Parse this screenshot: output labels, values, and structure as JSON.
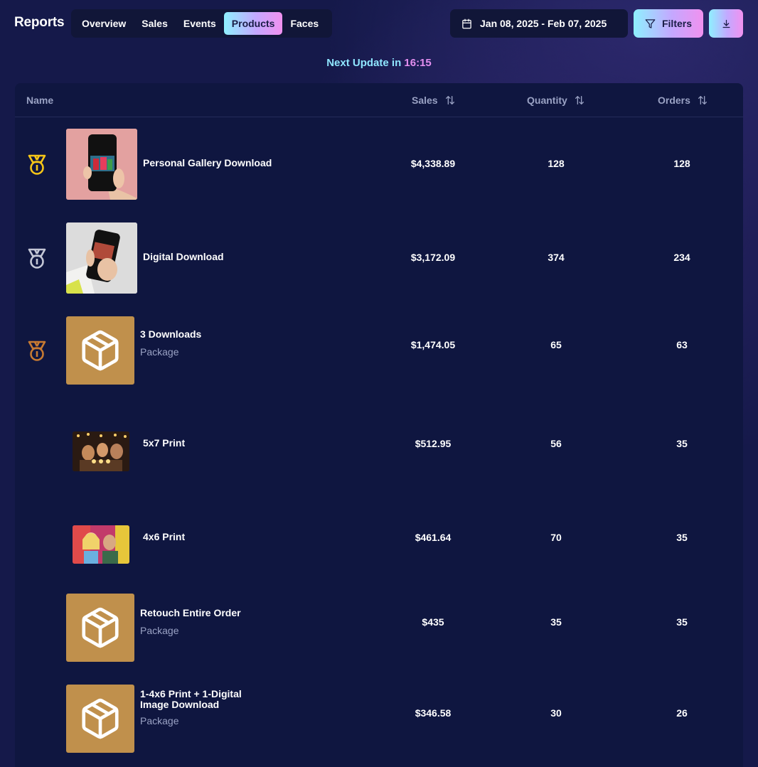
{
  "header": {
    "title": "Reports",
    "tabs": [
      "Overview",
      "Sales",
      "Events",
      "Products",
      "Faces"
    ],
    "active_tab": "Products",
    "date_range": "Jan 08, 2025 - Feb 07, 2025",
    "filters_label": "Filters",
    "download_icon": "download-icon",
    "calendar_icon": "calendar-icon",
    "filter_icon": "filter-icon"
  },
  "update": {
    "label": "Next Update in",
    "time": "16:15"
  },
  "table": {
    "columns": {
      "name": "Name",
      "sales": "Sales",
      "quantity": "Quantity",
      "orders": "Orders"
    },
    "sort_icon": "sort-arrows-icon",
    "rows": [
      {
        "name": "Personal Gallery Download",
        "subtitle": "",
        "sales": "$4,338.89",
        "quantity": "128",
        "orders": "128",
        "rank": "gold",
        "thumb": "phone-photo-pink"
      },
      {
        "name": "Digital Download",
        "subtitle": "",
        "sales": "$3,172.09",
        "quantity": "374",
        "orders": "234",
        "rank": "silver",
        "thumb": "phone-photo-white"
      },
      {
        "name": "3 Downloads",
        "subtitle": "Package",
        "sales": "$1,474.05",
        "quantity": "65",
        "orders": "63",
        "rank": "bronze",
        "thumb": "package-icon"
      },
      {
        "name": "5x7 Print",
        "subtitle": "",
        "sales": "$512.95",
        "quantity": "56",
        "orders": "35",
        "rank": "",
        "thumb": "party-photo"
      },
      {
        "name": "4x6 Print",
        "subtitle": "",
        "sales": "$461.64",
        "quantity": "70",
        "orders": "35",
        "rank": "",
        "thumb": "festival-photo"
      },
      {
        "name": "Retouch Entire Order",
        "subtitle": "Package",
        "sales": "$435",
        "quantity": "35",
        "orders": "35",
        "rank": "",
        "thumb": "package-icon"
      },
      {
        "name": "1-4x6 Print + 1-Digital Image Download",
        "subtitle": "Package",
        "sales": "$346.58",
        "quantity": "30",
        "orders": "26",
        "rank": "",
        "thumb": "package-icon"
      }
    ]
  },
  "colors": {
    "background": "#15194a",
    "table_bg": "#0f1640",
    "accent_gradient": [
      "#8ff0ff",
      "#c4a8ff",
      "#f191ef"
    ],
    "gold": "#f5c518",
    "silver": "#c4c7d6",
    "bronze": "#c77a32",
    "package_bg": "#c0904c"
  }
}
